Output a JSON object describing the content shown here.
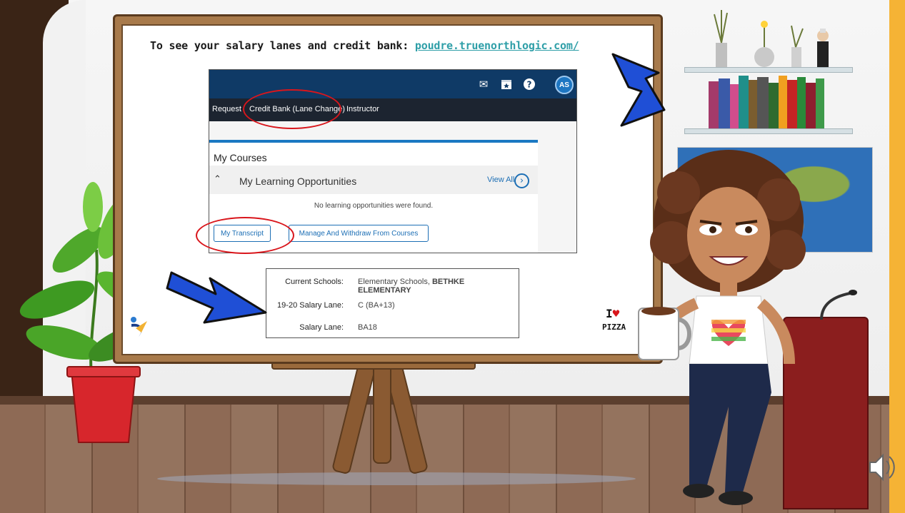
{
  "slide": {
    "headline_prefix": "To see your salary lanes and credit bank:",
    "headline_link": "poudre.truenorthlogic.com/",
    "love_label": "I",
    "love_heart": "♥",
    "pizza_label": "PIZZA"
  },
  "portal": {
    "topbar_icons": [
      "mail-icon",
      "calendar-star-icon",
      "help-icon"
    ],
    "avatar_initials": "AS",
    "nav": {
      "request": "Request",
      "credit_bank": "Credit Bank (Lane Change)",
      "instructor": "Instructor"
    },
    "section_title": "My Courses",
    "learning_title": "My Learning Opportunities",
    "view_all": "View All",
    "empty_message": "No learning opportunities were found.",
    "buttons": {
      "transcript": "My Transcript",
      "manage": "Manage And Withdraw From Courses"
    }
  },
  "profile": {
    "rows": [
      {
        "label": "Current Schools:",
        "value_prefix": "Elementary Schools, ",
        "value_strong": "BETHKE ELEMENTARY"
      },
      {
        "label": "19-20 Salary Lane:",
        "value": "C (BA+13)"
      },
      {
        "label": "Salary Lane:",
        "value": "BA18"
      }
    ]
  },
  "colors": {
    "portal_topbar": "#0f3a66",
    "portal_navbar": "#1c2430",
    "accent_blue": "#1a78c2",
    "highlight_red": "#d9161c",
    "link_teal": "#2f9fa8",
    "arrow_blue": "#1f4fd6"
  }
}
